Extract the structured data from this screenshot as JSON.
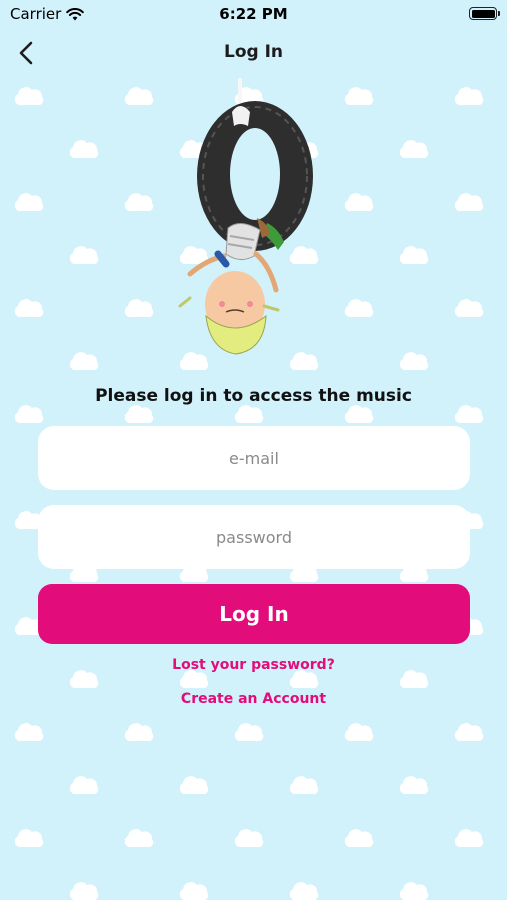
{
  "status_bar": {
    "carrier": "Carrier",
    "time": "6:22 PM",
    "wifi_icon": "wifi-icon",
    "battery_icon": "battery-icon"
  },
  "nav": {
    "title": "Log In",
    "back_icon": "chevron-left-icon"
  },
  "illustration": {
    "icon": "child-hanging-on-tire-swing-illustration"
  },
  "form": {
    "prompt": "Please log in to access the music",
    "email_placeholder": "e-mail",
    "email_value": "",
    "password_placeholder": "password",
    "password_value": "",
    "login_label": "Log In"
  },
  "links": {
    "lost_password": "Lost your password?",
    "create_account": "Create an Account"
  },
  "colors": {
    "background": "#d1f1fb",
    "cloud": "#ffffff",
    "accent": "#e30c7b",
    "field": "#ffffff"
  }
}
